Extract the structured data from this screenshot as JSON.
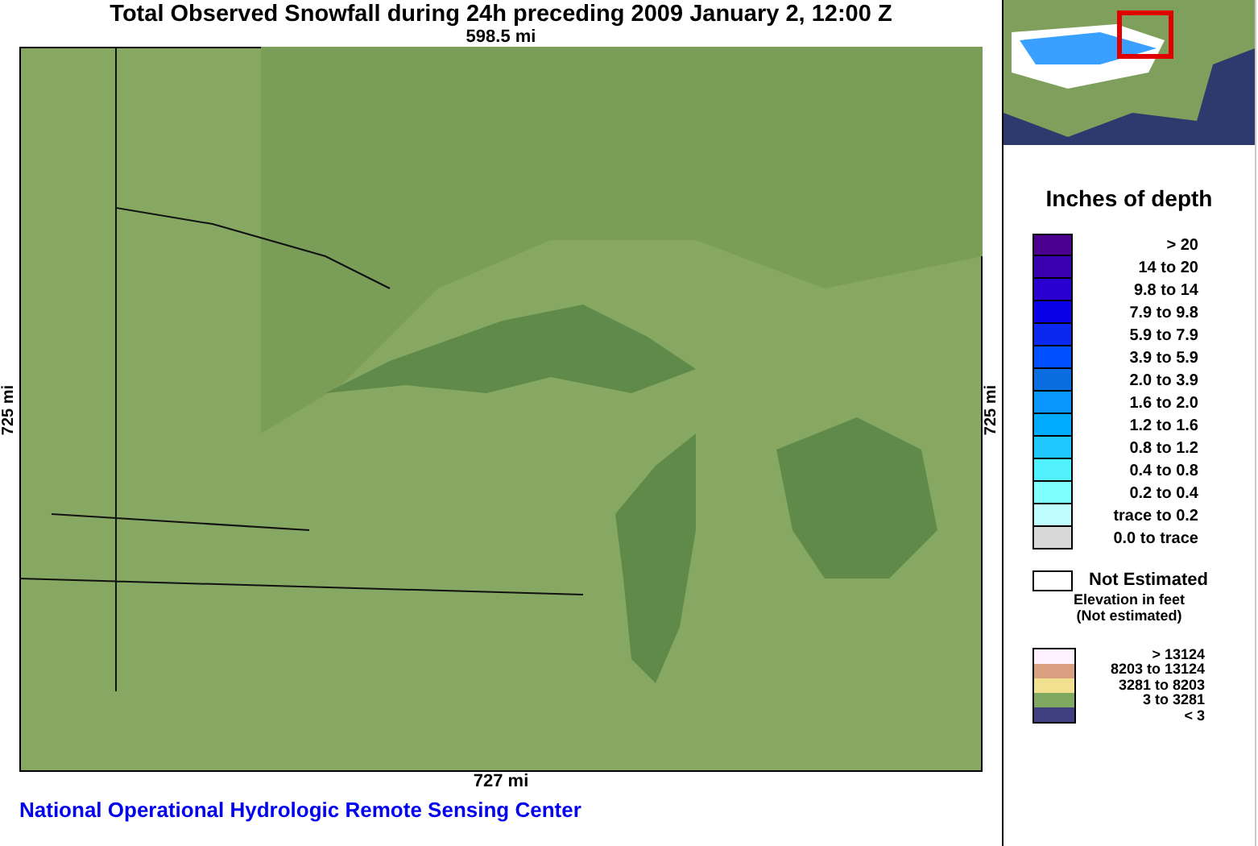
{
  "title": "Total Observed Snowfall during 24h preceding 2009 January 2, 12:00 Z",
  "top_scale": "598.5 mi",
  "left_scale": "725 mi",
  "right_scale": "725 mi",
  "bottom_scale": "727 mi",
  "footer": "National Operational Hydrologic Remote Sensing Center",
  "legend": {
    "title": "Inches of depth",
    "items": [
      {
        "label": "> 20",
        "color": "#4b0090"
      },
      {
        "label": "14 to 20",
        "color": "#3a00b0"
      },
      {
        "label": "9.8 to 14",
        "color": "#2a00d0"
      },
      {
        "label": "7.9 to 9.8",
        "color": "#0a00e8"
      },
      {
        "label": "5.9 to 7.9",
        "color": "#0a28f0"
      },
      {
        "label": "3.9 to 5.9",
        "color": "#0050ff"
      },
      {
        "label": "2.0 to 3.9",
        "color": "#0a6ee0"
      },
      {
        "label": "1.6 to 2.0",
        "color": "#0a96ff"
      },
      {
        "label": "1.2 to 1.6",
        "color": "#00aaff"
      },
      {
        "label": "0.8 to 1.2",
        "color": "#1ec8ff"
      },
      {
        "label": "0.4 to 0.8",
        "color": "#50f0ff"
      },
      {
        "label": "0.2 to 0.4",
        "color": "#80ffff"
      },
      {
        "label": "trace to 0.2",
        "color": "#c0ffff"
      },
      {
        "label": "0.0 to trace",
        "color": "#d8d8d8"
      }
    ],
    "not_estimated": "Not Estimated"
  },
  "elevation": {
    "title": "Elevation in feet",
    "subtitle": "(Not estimated)",
    "items": [
      {
        "label": "> 13124",
        "color": "#fff0ff"
      },
      {
        "label": "8203 to 13124",
        "color": "#d8a080"
      },
      {
        "label": "3281 to 8203",
        "color": "#f0e090"
      },
      {
        "label": "3 to 3281",
        "color": "#80a860"
      },
      {
        "label": "< 3",
        "color": "#404080"
      }
    ]
  }
}
